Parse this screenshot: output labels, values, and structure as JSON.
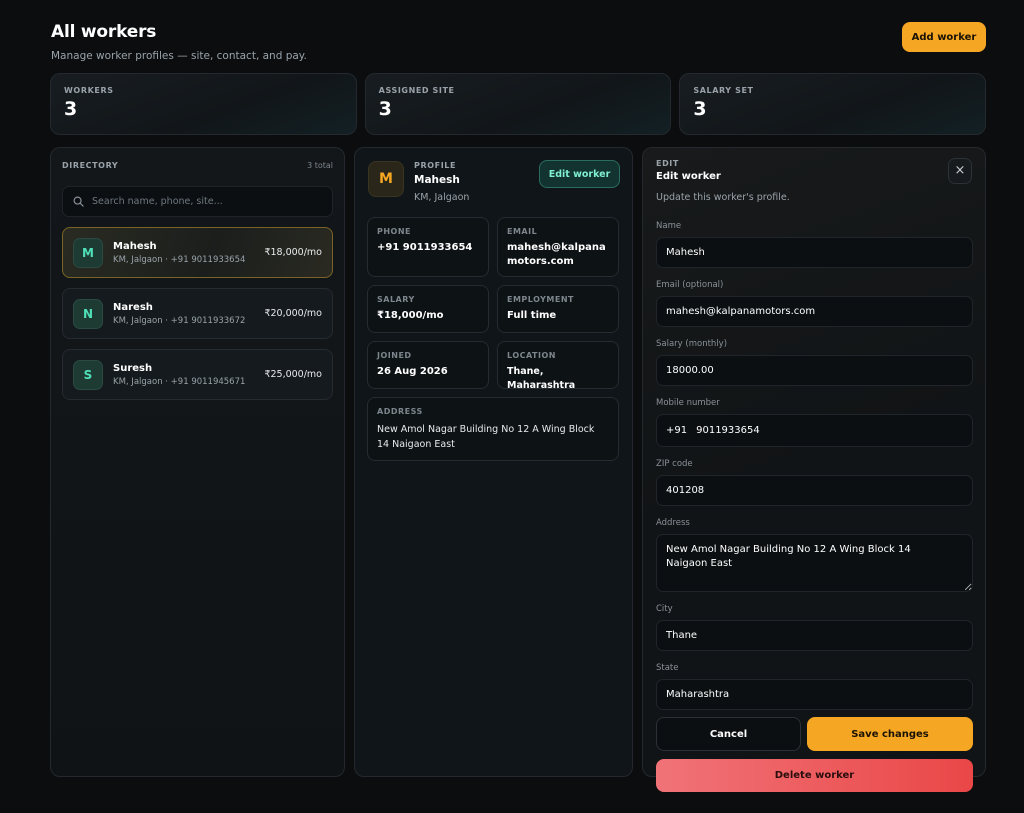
{
  "header": {
    "title": "All workers",
    "subtitle": "Manage worker profiles — site, contact, and pay.",
    "add_button": "Add worker"
  },
  "stats": [
    {
      "label": "WORKERS",
      "value": "3"
    },
    {
      "label": "ASSIGNED SITE",
      "value": "3"
    },
    {
      "label": "SALARY SET",
      "value": "3"
    }
  ],
  "directory": {
    "label": "DIRECTORY",
    "count": "3 total",
    "search_placeholder": "Search name, phone, site...",
    "workers": [
      {
        "initial": "M",
        "name": "Mahesh",
        "meta": "KM, Jalgaon · +91 9011933654",
        "pay": "₹18,000/mo"
      },
      {
        "initial": "N",
        "name": "Naresh",
        "meta": "KM, Jalgaon · +91 9011933672",
        "pay": "₹20,000/mo"
      },
      {
        "initial": "S",
        "name": "Suresh",
        "meta": "KM, Jalgaon · +91 9011945671",
        "pay": "₹25,000/mo"
      }
    ]
  },
  "profile": {
    "label": "PROFILE",
    "initial": "M",
    "name": "Mahesh",
    "location": "KM, Jalgaon",
    "edit_button": "Edit worker",
    "phone_label": "PHONE",
    "phone": "+91 9011933654",
    "email_label": "EMAIL",
    "email": "mahesh@kalpanamotors.com",
    "salary_label": "SALARY",
    "salary": "₹18,000/mo",
    "employment_label": "EMPLOYMENT",
    "employment": "Full time",
    "joined_label": "JOINED",
    "joined": "26 Aug 2026",
    "location_label": "LOCATION",
    "location_value": "Thane, Maharashtra",
    "address_label": "ADDRESS",
    "address": "New Amol Nagar Building No 12 A Wing Block 14 Naigaon East"
  },
  "edit": {
    "label": "EDIT",
    "title": "Edit worker",
    "subtitle": "Update this worker's profile.",
    "close": "×",
    "name_label": "Name",
    "name": "Mahesh",
    "email_label": "Email (optional)",
    "email": "mahesh@kalpanamotors.com",
    "salary_label": "Salary (monthly)",
    "salary": "18000.00",
    "mobile_label": "Mobile number",
    "country_code": "+91",
    "mobile": "9011933654",
    "zip_label": "ZIP code",
    "zip": "401208",
    "address_label": "Address",
    "address": "New Amol Nagar Building No 12 A Wing Block 14\nNaigaon East",
    "city_label": "City",
    "city": "Thane",
    "state_label": "State",
    "state": "Maharashtra",
    "cancel": "Cancel",
    "save": "Save changes",
    "delete": "Delete worker"
  }
}
